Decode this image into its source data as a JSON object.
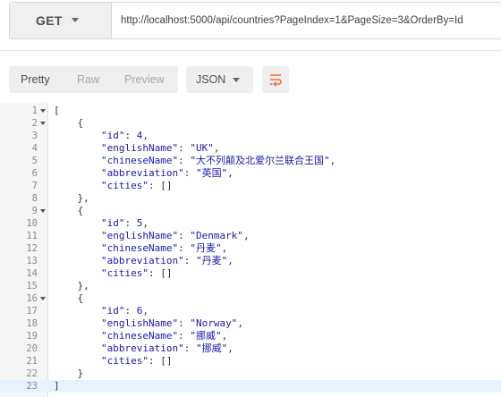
{
  "request": {
    "method": "GET",
    "url": "http://localhost:5000/api/countries?PageIndex=1&PageSize=3&OrderBy=Id"
  },
  "response_toolbar": {
    "tabs": [
      {
        "label": "Pretty",
        "active": true
      },
      {
        "label": "Raw",
        "active": false
      },
      {
        "label": "Preview",
        "active": false
      }
    ],
    "format": "JSON",
    "wrap_icon": "wrap-lines-icon",
    "accent_color": "#f26b3a"
  },
  "code": {
    "current_line": 23,
    "lines": [
      {
        "n": "1",
        "fold": true,
        "tokens": [
          [
            "p",
            "["
          ]
        ]
      },
      {
        "n": "2",
        "fold": true,
        "tokens": [
          [
            "p",
            "    {"
          ]
        ]
      },
      {
        "n": "3",
        "fold": false,
        "tokens": [
          [
            "p",
            "        "
          ],
          [
            "key",
            "\"id\""
          ],
          [
            "p",
            ": "
          ],
          [
            "num",
            "4"
          ],
          [
            "p",
            ","
          ]
        ]
      },
      {
        "n": "4",
        "fold": false,
        "tokens": [
          [
            "p",
            "        "
          ],
          [
            "key",
            "\"englishName\""
          ],
          [
            "p",
            ": "
          ],
          [
            "str",
            "\"UK\""
          ],
          [
            "p",
            ","
          ]
        ]
      },
      {
        "n": "5",
        "fold": false,
        "tokens": [
          [
            "p",
            "        "
          ],
          [
            "key",
            "\"chineseName\""
          ],
          [
            "p",
            ": "
          ],
          [
            "str",
            "\"大不列颠及北爱尔兰联合王国\""
          ],
          [
            "p",
            ","
          ]
        ]
      },
      {
        "n": "6",
        "fold": false,
        "tokens": [
          [
            "p",
            "        "
          ],
          [
            "key",
            "\"abbreviation\""
          ],
          [
            "p",
            ": "
          ],
          [
            "str",
            "\"英国\""
          ],
          [
            "p",
            ","
          ]
        ]
      },
      {
        "n": "7",
        "fold": false,
        "tokens": [
          [
            "p",
            "        "
          ],
          [
            "key",
            "\"cities\""
          ],
          [
            "p",
            ": []"
          ]
        ]
      },
      {
        "n": "8",
        "fold": false,
        "tokens": [
          [
            "p",
            "    },"
          ]
        ]
      },
      {
        "n": "9",
        "fold": true,
        "tokens": [
          [
            "p",
            "    {"
          ]
        ]
      },
      {
        "n": "10",
        "fold": false,
        "tokens": [
          [
            "p",
            "        "
          ],
          [
            "key",
            "\"id\""
          ],
          [
            "p",
            ": "
          ],
          [
            "num",
            "5"
          ],
          [
            "p",
            ","
          ]
        ]
      },
      {
        "n": "11",
        "fold": false,
        "tokens": [
          [
            "p",
            "        "
          ],
          [
            "key",
            "\"englishName\""
          ],
          [
            "p",
            ": "
          ],
          [
            "str",
            "\"Denmark\""
          ],
          [
            "p",
            ","
          ]
        ]
      },
      {
        "n": "12",
        "fold": false,
        "tokens": [
          [
            "p",
            "        "
          ],
          [
            "key",
            "\"chineseName\""
          ],
          [
            "p",
            ": "
          ],
          [
            "str",
            "\"丹麦\""
          ],
          [
            "p",
            ","
          ]
        ]
      },
      {
        "n": "13",
        "fold": false,
        "tokens": [
          [
            "p",
            "        "
          ],
          [
            "key",
            "\"abbreviation\""
          ],
          [
            "p",
            ": "
          ],
          [
            "str",
            "\"丹麦\""
          ],
          [
            "p",
            ","
          ]
        ]
      },
      {
        "n": "14",
        "fold": false,
        "tokens": [
          [
            "p",
            "        "
          ],
          [
            "key",
            "\"cities\""
          ],
          [
            "p",
            ": []"
          ]
        ]
      },
      {
        "n": "15",
        "fold": false,
        "tokens": [
          [
            "p",
            "    },"
          ]
        ]
      },
      {
        "n": "16",
        "fold": true,
        "tokens": [
          [
            "p",
            "    {"
          ]
        ]
      },
      {
        "n": "17",
        "fold": false,
        "tokens": [
          [
            "p",
            "        "
          ],
          [
            "key",
            "\"id\""
          ],
          [
            "p",
            ": "
          ],
          [
            "num",
            "6"
          ],
          [
            "p",
            ","
          ]
        ]
      },
      {
        "n": "18",
        "fold": false,
        "tokens": [
          [
            "p",
            "        "
          ],
          [
            "key",
            "\"englishName\""
          ],
          [
            "p",
            ": "
          ],
          [
            "str",
            "\"Norway\""
          ],
          [
            "p",
            ","
          ]
        ]
      },
      {
        "n": "19",
        "fold": false,
        "tokens": [
          [
            "p",
            "        "
          ],
          [
            "key",
            "\"chineseName\""
          ],
          [
            "p",
            ": "
          ],
          [
            "str",
            "\"挪威\""
          ],
          [
            "p",
            ","
          ]
        ]
      },
      {
        "n": "20",
        "fold": false,
        "tokens": [
          [
            "p",
            "        "
          ],
          [
            "key",
            "\"abbreviation\""
          ],
          [
            "p",
            ": "
          ],
          [
            "str",
            "\"挪威\""
          ],
          [
            "p",
            ","
          ]
        ]
      },
      {
        "n": "21",
        "fold": false,
        "tokens": [
          [
            "p",
            "        "
          ],
          [
            "key",
            "\"cities\""
          ],
          [
            "p",
            ": []"
          ]
        ]
      },
      {
        "n": "22",
        "fold": false,
        "tokens": [
          [
            "p",
            "    }"
          ]
        ]
      },
      {
        "n": "23",
        "fold": false,
        "tokens": [
          [
            "p",
            "]"
          ]
        ]
      }
    ]
  }
}
